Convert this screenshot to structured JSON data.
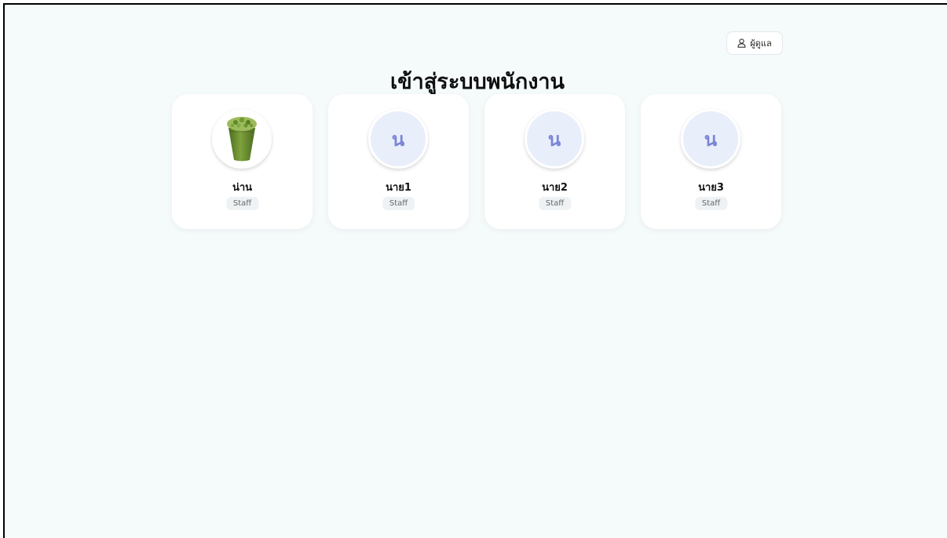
{
  "header": {
    "admin_label": "ผู้ดูแล",
    "admin_icon": "user-icon"
  },
  "page": {
    "title": "เข้าสู่ระบบพนักงาน"
  },
  "staff": [
    {
      "name": "น่าน",
      "role": "Staff",
      "avatar": "green-drink-photo"
    },
    {
      "name": "นาย1",
      "role": "Staff",
      "avatar_letter": "น"
    },
    {
      "name": "นาย2",
      "role": "Staff",
      "avatar_letter": "น"
    },
    {
      "name": "นาย3",
      "role": "Staff",
      "avatar_letter": "น"
    }
  ],
  "colors": {
    "background": "#f5fafb",
    "card": "#ffffff",
    "avatar_bg": "#e9eefb",
    "avatar_letter": "#7a86d6",
    "badge_bg": "#eef2f4"
  }
}
